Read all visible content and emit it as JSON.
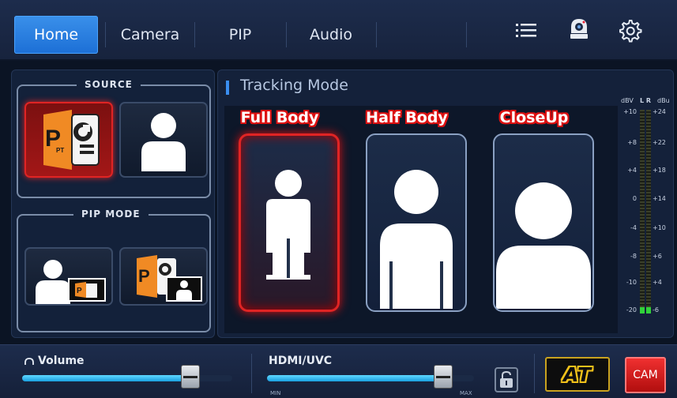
{
  "tabs": [
    {
      "label": "Home",
      "active": true
    },
    {
      "label": "Camera",
      "active": false
    },
    {
      "label": "PIP",
      "active": false
    },
    {
      "label": "Audio",
      "active": false
    }
  ],
  "top_icons": [
    "list-icon",
    "camera-device-icon",
    "settings-gear-icon"
  ],
  "source": {
    "title": "SOURCE",
    "items": [
      {
        "name": "ppt-presentation-icon",
        "selected": true
      },
      {
        "name": "person-camera-icon",
        "selected": false
      }
    ]
  },
  "pip_mode": {
    "title": "PIP MODE",
    "items": [
      {
        "name": "pip-person-main-icon"
      },
      {
        "name": "pip-ppt-main-icon"
      }
    ]
  },
  "tracking": {
    "title": "Tracking Mode",
    "modes": [
      {
        "label": "Full Body",
        "selected": true
      },
      {
        "label": "Half Body",
        "selected": false
      },
      {
        "label": "CloseUp",
        "selected": false
      }
    ]
  },
  "vu_meter": {
    "header_left": "dBV",
    "header_channels": "L R",
    "header_right": "dBu",
    "left_ticks": [
      "+10",
      "+8",
      "+4",
      "0",
      "-4",
      "-8",
      "-10",
      "-20"
    ],
    "right_ticks": [
      "+24",
      "+22",
      "+18",
      "+14",
      "+10",
      "+6",
      "+4",
      "-6"
    ],
    "level_l": 0.03,
    "level_r": 0.03
  },
  "bottom": {
    "volume_label": "Volume",
    "volume_level": 0.8,
    "hdmi_label": "HDMI/UVC",
    "hdmi_level": 0.85,
    "hdmi_min": "MIN",
    "hdmi_max": "MAX",
    "at_label": "AT",
    "cam_label": "CAM"
  },
  "colors": {
    "accent": "#2a7fe6",
    "selected": "#e02424",
    "at_gold": "#f2c21a"
  }
}
